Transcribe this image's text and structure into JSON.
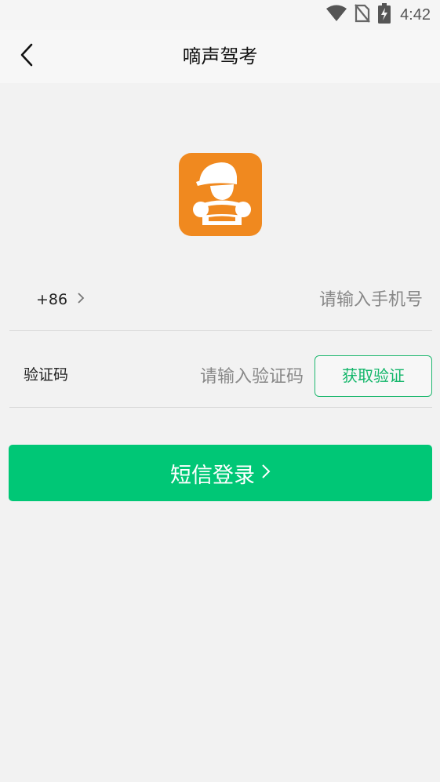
{
  "status_bar": {
    "time": "4:42",
    "icons": [
      "wifi-icon",
      "no-sim-icon",
      "battery-charging-icon"
    ]
  },
  "nav": {
    "title": "嘀声驾考",
    "back_icon": "chevron-left-icon"
  },
  "logo": {
    "icon": "driver-at-wheel-icon",
    "background": "#f0891f"
  },
  "phone": {
    "country_code": "+86",
    "placeholder": "请输入手机号",
    "value": ""
  },
  "verification": {
    "label": "验证码",
    "placeholder": "请输入验证码",
    "value": "",
    "button_label": "获取验证"
  },
  "login": {
    "label": "短信登录"
  },
  "colors": {
    "accent": "#00c776",
    "accent_text": "#13b66a",
    "brand_orange": "#f0891f",
    "background": "#f2f2f2"
  }
}
